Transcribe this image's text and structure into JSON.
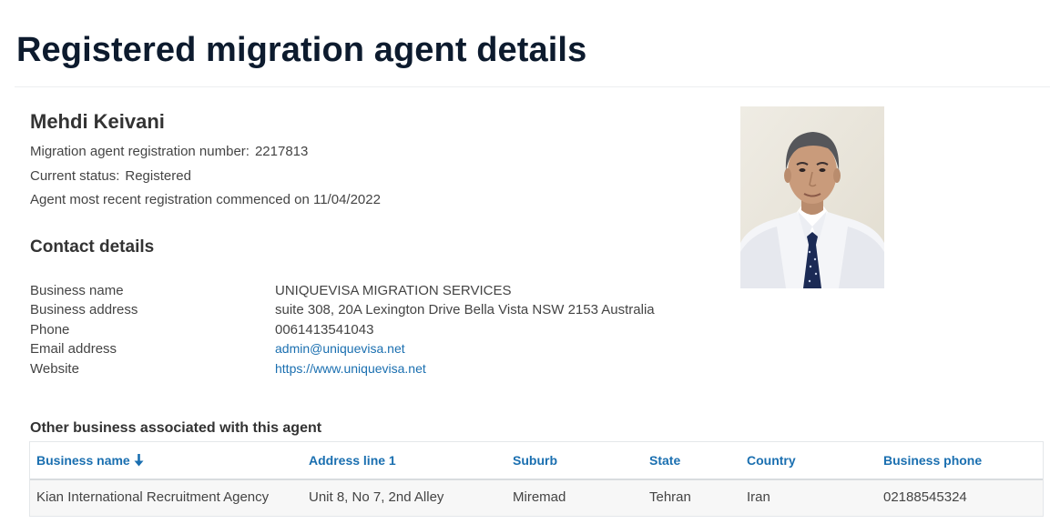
{
  "page": {
    "title": "Registered migration agent details"
  },
  "agent": {
    "name": "Mehdi Keivani",
    "registration_label": "Migration agent registration number:",
    "registration_number": "2217813",
    "status_label": "Current status:",
    "status_value": "Registered",
    "commenced_text": "Agent most recent registration commenced on 11/04/2022"
  },
  "contact": {
    "heading": "Contact details",
    "rows": [
      {
        "label": "Business name",
        "value": "UNIQUEVISA MIGRATION SERVICES"
      },
      {
        "label": "Business address",
        "value": "suite 308, 20A Lexington Drive Bella Vista NSW 2153 Australia"
      },
      {
        "label": "Phone",
        "value": "0061413541043"
      },
      {
        "label": "Email address",
        "value": "admin@uniquevisa.net"
      },
      {
        "label": "Website",
        "value": "https://www.uniquevisa.net"
      }
    ]
  },
  "other_business": {
    "heading": "Other business associated with this agent",
    "columns": [
      "Business name",
      "Address line 1",
      "Suburb",
      "State",
      "Country",
      "Business phone"
    ],
    "sort_icon": "arrow-down-icon",
    "rows": [
      [
        "Kian International Recruitment Agency",
        "Unit 8, No 7, 2nd Alley",
        "Miremad",
        "Tehran",
        "Iran",
        "02188545324"
      ]
    ]
  },
  "colors": {
    "title": "#0d1b2e",
    "link": "#1a6fb0",
    "text": "#444444",
    "row_bg": "#f7f7f7"
  }
}
